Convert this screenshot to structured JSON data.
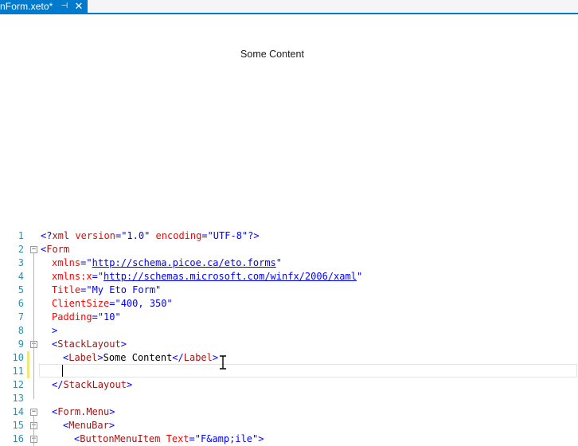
{
  "tab": {
    "title": "nForm.xeto*",
    "pin_glyph": "⊣",
    "close_glyph": "✕"
  },
  "preview": {
    "label": "Some Content"
  },
  "editor": {
    "lines": [
      {
        "n": "1",
        "changed": false,
        "fold": "",
        "tokens": [
          {
            "t": "br",
            "v": "<?"
          },
          {
            "t": "tag",
            "v": "xml"
          },
          {
            "t": "text",
            "v": " "
          },
          {
            "t": "attr",
            "v": "version"
          },
          {
            "t": "br",
            "v": "="
          },
          {
            "t": "val",
            "v": "\"1.0\""
          },
          {
            "t": "text",
            "v": " "
          },
          {
            "t": "attr",
            "v": "encoding"
          },
          {
            "t": "br",
            "v": "="
          },
          {
            "t": "val",
            "v": "\"UTF-8\""
          },
          {
            "t": "br",
            "v": "?>"
          }
        ],
        "indent": 0
      },
      {
        "n": "2",
        "changed": false,
        "fold": "minus",
        "tokens": [
          {
            "t": "br",
            "v": "<"
          },
          {
            "t": "tag",
            "v": "Form"
          }
        ],
        "indent": 0
      },
      {
        "n": "3",
        "changed": false,
        "fold": "",
        "tokens": [
          {
            "t": "attr",
            "v": "xmlns"
          },
          {
            "t": "br",
            "v": "="
          },
          {
            "t": "val",
            "v": "\""
          },
          {
            "t": "url",
            "v": "http://schema.picoe.ca/eto.forms"
          },
          {
            "t": "val",
            "v": "\""
          }
        ],
        "indent": 1
      },
      {
        "n": "4",
        "changed": false,
        "fold": "",
        "tokens": [
          {
            "t": "attr",
            "v": "xmlns:x"
          },
          {
            "t": "br",
            "v": "="
          },
          {
            "t": "val",
            "v": "\""
          },
          {
            "t": "url",
            "v": "http://schemas.microsoft.com/winfx/2006/xaml"
          },
          {
            "t": "val",
            "v": "\""
          }
        ],
        "indent": 1
      },
      {
        "n": "5",
        "changed": false,
        "fold": "",
        "tokens": [
          {
            "t": "attr",
            "v": "Title"
          },
          {
            "t": "br",
            "v": "="
          },
          {
            "t": "val",
            "v": "\"My Eto Form\""
          }
        ],
        "indent": 1
      },
      {
        "n": "6",
        "changed": false,
        "fold": "",
        "tokens": [
          {
            "t": "attr",
            "v": "ClientSize"
          },
          {
            "t": "br",
            "v": "="
          },
          {
            "t": "val",
            "v": "\"400, 350\""
          }
        ],
        "indent": 1
      },
      {
        "n": "7",
        "changed": false,
        "fold": "",
        "tokens": [
          {
            "t": "attr",
            "v": "Padding"
          },
          {
            "t": "br",
            "v": "="
          },
          {
            "t": "val",
            "v": "\"10\""
          }
        ],
        "indent": 1
      },
      {
        "n": "8",
        "changed": false,
        "fold": "",
        "tokens": [
          {
            "t": "br",
            "v": ">"
          }
        ],
        "indent": 1
      },
      {
        "n": "9",
        "changed": false,
        "fold": "minus",
        "tokens": [
          {
            "t": "br",
            "v": "<"
          },
          {
            "t": "tag",
            "v": "StackLayout"
          },
          {
            "t": "br",
            "v": ">"
          }
        ],
        "indent": 1
      },
      {
        "n": "10",
        "changed": true,
        "fold": "",
        "tokens": [
          {
            "t": "br",
            "v": "<"
          },
          {
            "t": "tag",
            "v": "Label"
          },
          {
            "t": "br",
            "v": ">"
          },
          {
            "t": "text",
            "v": "Some Content"
          },
          {
            "t": "br",
            "v": "</"
          },
          {
            "t": "tag",
            "v": "Label"
          },
          {
            "t": "br",
            "v": ">"
          }
        ],
        "indent": 2
      },
      {
        "n": "11",
        "changed": true,
        "fold": "",
        "tokens": [],
        "indent": 2
      },
      {
        "n": "12",
        "changed": false,
        "fold": "",
        "tokens": [
          {
            "t": "br",
            "v": "</"
          },
          {
            "t": "tag",
            "v": "StackLayout"
          },
          {
            "t": "br",
            "v": ">"
          }
        ],
        "indent": 1
      },
      {
        "n": "13",
        "changed": false,
        "fold": "",
        "tokens": [],
        "indent": 0
      },
      {
        "n": "14",
        "changed": false,
        "fold": "minus",
        "tokens": [
          {
            "t": "br",
            "v": "<"
          },
          {
            "t": "tag",
            "v": "Form.Menu"
          },
          {
            "t": "br",
            "v": ">"
          }
        ],
        "indent": 1
      },
      {
        "n": "15",
        "changed": false,
        "fold": "minus",
        "tokens": [
          {
            "t": "br",
            "v": "<"
          },
          {
            "t": "tag",
            "v": "MenuBar"
          },
          {
            "t": "br",
            "v": ">"
          }
        ],
        "indent": 2
      },
      {
        "n": "16",
        "changed": false,
        "fold": "minus",
        "tokens": [
          {
            "t": "br",
            "v": "<"
          },
          {
            "t": "tag",
            "v": "ButtonMenuItem"
          },
          {
            "t": "text",
            "v": " "
          },
          {
            "t": "attr",
            "v": "Text"
          },
          {
            "t": "br",
            "v": "="
          },
          {
            "t": "val",
            "v": "\"F&amp;ile\""
          },
          {
            "t": "br",
            "v": ">"
          }
        ],
        "indent": 3
      }
    ]
  },
  "colors": {
    "accent": "#007acc",
    "line_number": "#2b91af",
    "tag": "#a31515",
    "attribute": "#ff0000",
    "value": "#0000ff",
    "change_marker": "#efe77a"
  }
}
